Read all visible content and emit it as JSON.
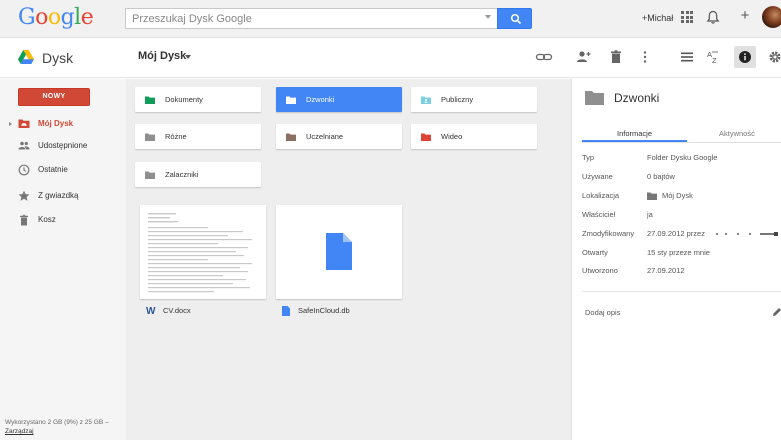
{
  "topbar": {
    "logo": [
      "G",
      "o",
      "o",
      "g",
      "l",
      "e"
    ],
    "search_placeholder": "Przeszukaj Dysk Google",
    "user_name": "+Michał"
  },
  "subbar": {
    "app_name": "Dysk",
    "breadcrumb": "Mój Dysk"
  },
  "sidebar": {
    "new_button": "NOWY",
    "items": [
      {
        "label": "Mój Dysk",
        "icon": "drive-folder-icon",
        "active": true
      },
      {
        "label": "Udostępnione",
        "icon": "people-icon"
      },
      {
        "label": "Ostatnie",
        "icon": "clock-icon"
      },
      {
        "label": "Z gwiazdką",
        "icon": "star-icon"
      },
      {
        "label": "Kosz",
        "icon": "trash-icon"
      }
    ],
    "storage_text": "Wykorzystano 2 GB (9%) z 25 GB – ",
    "storage_link": "Zarządzaj"
  },
  "folders": [
    {
      "name": "Dokumenty",
      "color": "#0f9d58"
    },
    {
      "name": "Dzwonki",
      "color": "#ffffff",
      "selected": true
    },
    {
      "name": "Publiczny",
      "color": "#7bd0df"
    },
    {
      "name": "Różne",
      "color": "#8f8f8f"
    },
    {
      "name": "Uczelniane",
      "color": "#8d6e63"
    },
    {
      "name": "Wideo",
      "color": "#db4437"
    },
    {
      "name": "Zalaczniki",
      "color": "#8f8f8f"
    }
  ],
  "files": [
    {
      "name": "CV.docx",
      "icon": "word-icon"
    },
    {
      "name": "SafeInCloud.db",
      "icon": "file-icon"
    }
  ],
  "details": {
    "title": "Dzwonki",
    "tabs": [
      "Informacje",
      "Aktywność"
    ],
    "rows": [
      {
        "key": "Typ",
        "value": "Folder Dysku Google"
      },
      {
        "key": "Używane",
        "value": "0 bajtów"
      },
      {
        "key": "Lokalizacja",
        "value": "Mój Dysk"
      },
      {
        "key": "Właściciel",
        "value": "ja"
      },
      {
        "key": "Zmodyfikowany",
        "value": "27.09.2012 przez"
      },
      {
        "key": "Otwarty",
        "value": "15 sty przeze mnie"
      },
      {
        "key": "Utworzono",
        "value": "27.09.2012"
      }
    ],
    "add_description": "Dodaj opis"
  },
  "colors": {
    "accent": "#4285f4",
    "new_button": "#d14836",
    "sidebar_bg": "#f5f5f5",
    "main_bg": "#eeeeee"
  }
}
